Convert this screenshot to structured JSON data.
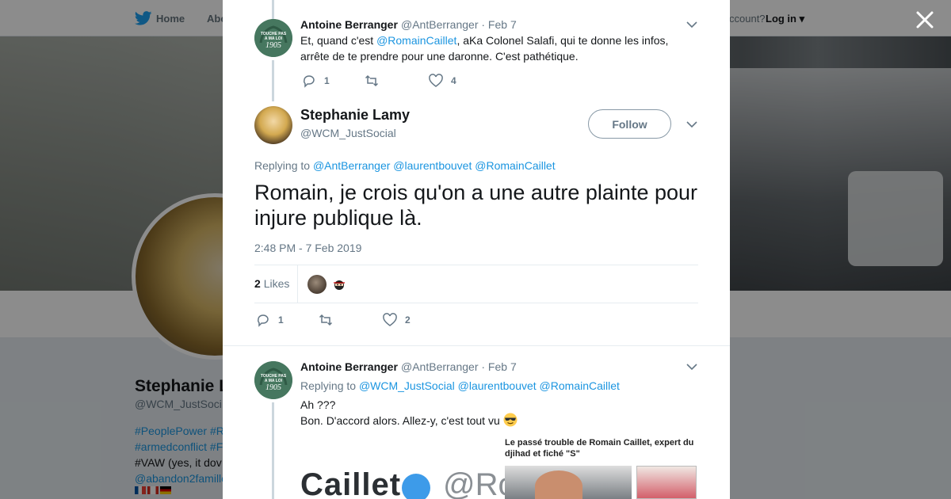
{
  "topnav": {
    "home_label": "Home",
    "about_label": "Abo",
    "account_text": "ccount?",
    "login_label": "Log in"
  },
  "background_profile": {
    "name": "Stephanie L",
    "handle": "@WCM_JustSoci",
    "bio_lines": [
      "#PeoplePower #R",
      "#armedconflict #F",
      "#VAW (yes, it dov",
      "@abandon2famille"
    ]
  },
  "thread": {
    "reply1": {
      "name": "Antoine Berranger",
      "handle": "@AntBerranger",
      "date": "· Feb 7",
      "text_before": "Et, quand c'est ",
      "text_mention": "@RomainCaillet",
      "text_after": ", aKa Colonel Salafi, qui te donne les infos, arrête de te prendre pour une daronne. C'est pathétique.",
      "reply_count": "1",
      "retweet_count": "",
      "like_count": "4"
    },
    "main": {
      "name": "Stephanie Lamy",
      "handle": "@WCM_JustSocial",
      "follow_label": "Follow",
      "replying_label": "Replying to",
      "replying_mentions": "@AntBerranger @laurentbouvet @RomainCaillet",
      "text": "Romain, je crois qu'on a une autre plainte pour injure publique là.",
      "timestamp": "2:48 PM - 7 Feb 2019",
      "likes_count": "2",
      "likes_label": "Likes",
      "reply_count": "1",
      "retweet_count": "",
      "like_count": "2"
    },
    "reply2": {
      "name": "Antoine Berranger",
      "handle": "@AntBerranger",
      "date": "· Feb 7",
      "replying_label": "Replying to",
      "replying_mentions": "@WCM_JustSocial @laurentbouvet @RomainCaillet",
      "line1": "Ah ???",
      "line2": "Bon. D'accord alors. Allez-y, c'est tout vu",
      "media": {
        "image_text_left": "Caillet",
        "image_text_right": "@Ro",
        "headline": "Le passé trouble de Romain Caillet, expert du djihad et fiché \"S\""
      }
    }
  },
  "colors": {
    "link": "#1b95e0",
    "muted": "#657786",
    "text": "#14171a",
    "avatar_green": "#46775f"
  },
  "icons": [
    "twitter-bird-icon",
    "close-icon",
    "chevron-down-icon",
    "reply-icon",
    "retweet-icon",
    "like-icon",
    "sunglasses-emoji-icon"
  ]
}
